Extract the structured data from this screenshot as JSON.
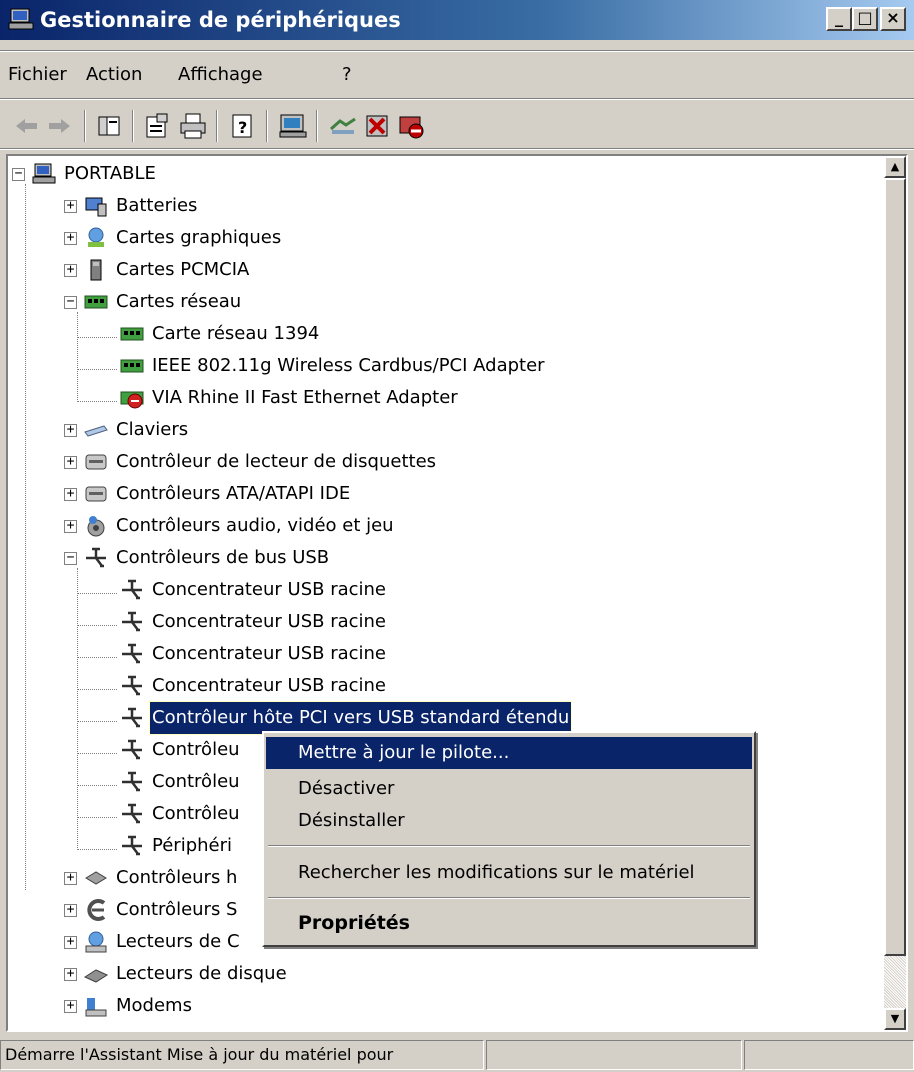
{
  "window": {
    "title": "Gestionnaire de périphériques"
  },
  "menu": [
    "Fichier",
    "Action",
    "Affichage",
    "?"
  ],
  "tree": {
    "root": "PORTABLE",
    "items": [
      {
        "label": "Batteries",
        "icon": "battery-icon"
      },
      {
        "label": "Cartes graphiques",
        "icon": "display-adapter-icon"
      },
      {
        "label": "Cartes PCMCIA",
        "icon": "pcmcia-icon"
      },
      {
        "label": "Cartes réseau",
        "icon": "network-card-icon"
      },
      {
        "label": "Carte réseau 1394",
        "icon": "network-card-icon"
      },
      {
        "label": "IEEE 802.11g Wireless Cardbus/PCI Adapter",
        "icon": "network-card-icon"
      },
      {
        "label": "VIA Rhine II Fast Ethernet Adapter",
        "icon": "network-card-disabled-icon"
      },
      {
        "label": "Claviers",
        "icon": "keyboard-icon"
      },
      {
        "label": "Contrôleur de lecteur de disquettes",
        "icon": "floppy-controller-icon"
      },
      {
        "label": "Contrôleurs ATA/ATAPI IDE",
        "icon": "ide-controller-icon"
      },
      {
        "label": "Contrôleurs audio, vidéo et jeu",
        "icon": "audio-icon"
      },
      {
        "label": "Contrôleurs de bus USB",
        "icon": "usb-icon"
      },
      {
        "label": "Concentrateur USB racine",
        "icon": "usb-icon"
      },
      {
        "label": "Concentrateur USB racine",
        "icon": "usb-icon"
      },
      {
        "label": "Concentrateur USB racine",
        "icon": "usb-icon"
      },
      {
        "label": "Concentrateur USB racine",
        "icon": "usb-icon"
      },
      {
        "label": "Contrôleur hôte PCI vers USB standard étendu",
        "icon": "usb-icon"
      },
      {
        "label": "Contrôleu",
        "icon": "usb-icon"
      },
      {
        "label": "Contrôleu",
        "icon": "usb-icon"
      },
      {
        "label": "Contrôleu",
        "icon": "usb-icon"
      },
      {
        "label": "Périphéri",
        "icon": "usb-icon"
      },
      {
        "label": "Contrôleurs h",
        "icon": "storage-controller-icon"
      },
      {
        "label": "Contrôleurs S",
        "icon": "scsi-controller-icon"
      },
      {
        "label": "Lecteurs de C",
        "icon": "cdrom-icon"
      },
      {
        "label": "Lecteurs de disque",
        "icon": "disk-drive-icon"
      },
      {
        "label": "Modems",
        "icon": "modem-icon"
      }
    ]
  },
  "context_menu": {
    "items": [
      "Mettre à jour le pilote...",
      "Désactiver",
      "Désinstaller",
      "Rechercher les modifications sur le matériel",
      "Propriétés"
    ]
  },
  "status": {
    "text": "Démarre l'Assistant Mise à jour du matériel pour"
  }
}
